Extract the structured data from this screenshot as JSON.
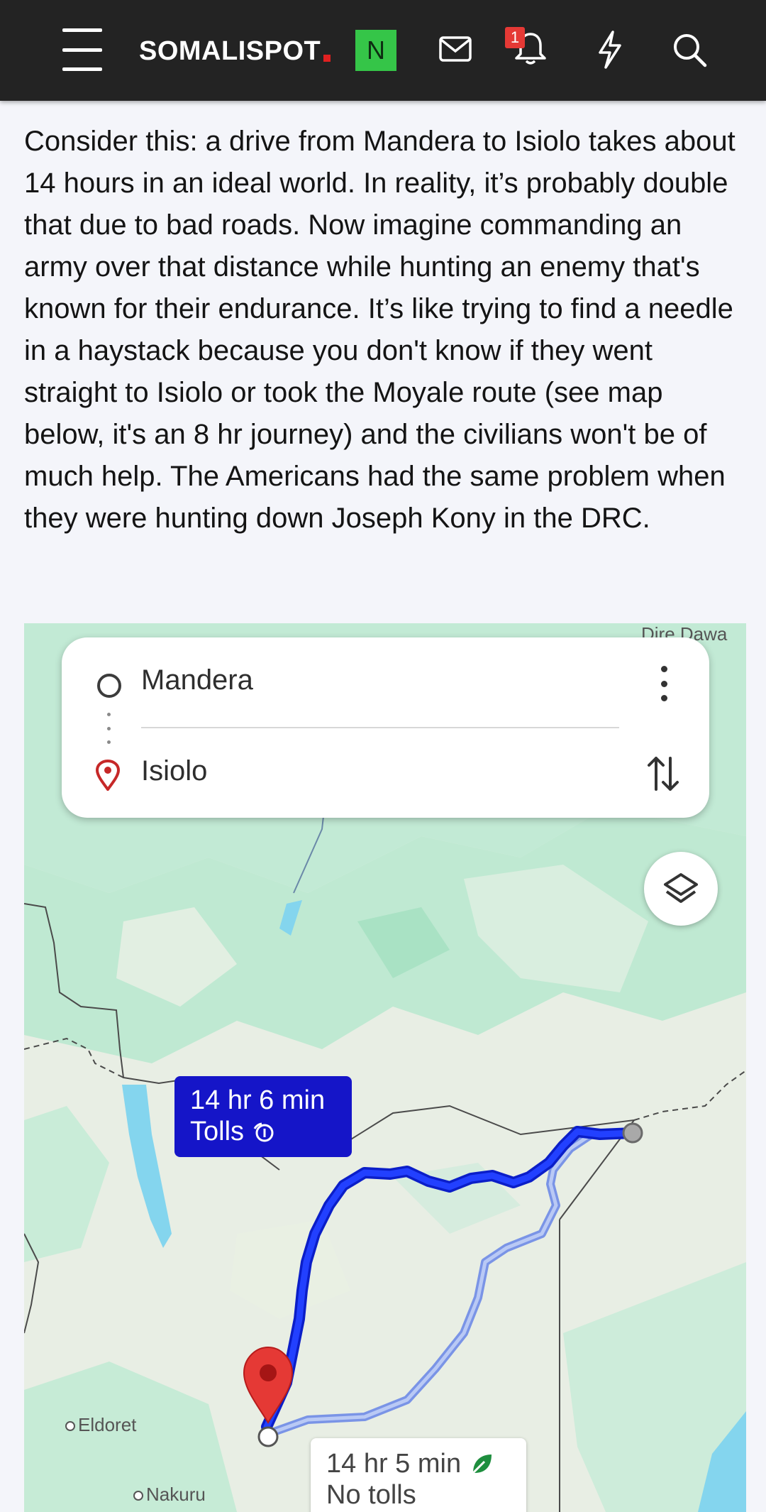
{
  "header": {
    "logo": "SOMALISPOT",
    "badge_letter": "N",
    "notification_count": "1",
    "icons": [
      "menu-icon",
      "mail-icon",
      "bell-icon",
      "bolt-icon",
      "search-icon"
    ]
  },
  "article": {
    "paragraph": "Consider this: a drive from Mandera to Isiolo takes about 14 hours in an ideal world. In reality, it’s probably double that due to bad roads. Now imagine commanding an army over that distance while hunting an enemy that's known for their endurance. It’s like trying to find a needle in a haystack because you don't know if they went straight to Isiolo or took the Moyale route (see map below, it's an 8 hr journey) and the civilians won't be of much help. The Americans had the same problem when they were hunting down Joseph Kony in the DRC."
  },
  "map": {
    "origin": "Mandera",
    "destination": "Isiolo",
    "route_main_time": "14 hr 6 min",
    "route_main_note": "Tolls",
    "route_alt_time": "14 hr 5 min",
    "route_alt_note": "No tolls",
    "places": [
      "Dire Dawa",
      "Eldoret",
      "Nakuru"
    ],
    "colors": {
      "route_main": "#1a1ae0",
      "route_alt": "#8fa8ea",
      "pin": "#e53935",
      "water": "#7fd3ee",
      "forest": "#b8e8cc"
    }
  }
}
